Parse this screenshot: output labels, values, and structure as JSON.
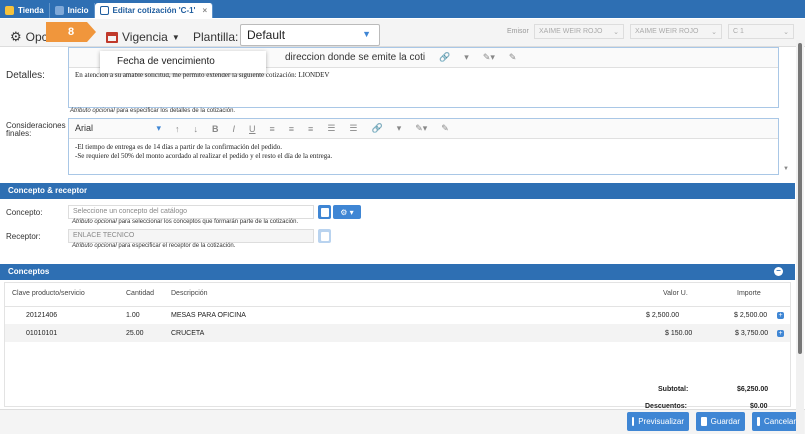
{
  "tabs": [
    {
      "label": "Tienda"
    },
    {
      "label": "Inicio"
    },
    {
      "label": "Editar cotización 'C-1'"
    }
  ],
  "toolbar": {
    "opciones": "Opc",
    "step_badge": "8",
    "vigencia": "Vigencia",
    "plantilla_label": "Plantilla:",
    "plantilla_value": "Default",
    "emisor_label": "Emisor",
    "emisor_value1": "XAIME WEIR ROJO",
    "emisor_value2": "XAIME WEIR ROJO",
    "serie": "C 1"
  },
  "dropdown": {
    "item": "Fecha de vencimiento"
  },
  "detalles": {
    "label": "Detalles:",
    "placeholder": "direccion donde se emite la coti",
    "text": "En atención a su amable solicitud, me permito extender la siguiente cotización: LIONDEV",
    "hint_em": "Atributo opcional",
    "hint_rest": " para especificar los detalles de la cotización."
  },
  "consideraciones": {
    "label1": "Consideraciones",
    "label2": "finales:",
    "font": "Arial",
    "line1": "-El tiempo de entrega es de 14 días a partir de la confirmación del pedido.",
    "line2": "-Se requiere del 50% del monto acordado al realizar el pedido y el resto el día de la entrega."
  },
  "concepto_receptor": {
    "title": "Concepto & receptor",
    "concepto_label": "Concepto:",
    "concepto_placeholder": "Seleccione un concepto del catálogo",
    "concepto_hint_em": "Atributo opcional",
    "concepto_hint": " para seleccionar los conceptos que formarán parte de la cotización.",
    "receptor_label": "Receptor:",
    "receptor_value": "ENLACE TECNICO",
    "receptor_hint_em": "Atributo opcional",
    "receptor_hint": " para especificar el receptor de la cotización."
  },
  "conceptos": {
    "title": "Conceptos",
    "headers": [
      "Clave producto/servicio",
      "Cantidad",
      "Descripción",
      "Valor U.",
      "Importe"
    ],
    "rows": [
      {
        "clave": "20121406",
        "cantidad": "1.00",
        "descripcion": "MESAS PARA OFICINA",
        "valor": "$ 2,500.00",
        "importe": "$ 2,500.00"
      },
      {
        "clave": "01010101",
        "cantidad": "25.00",
        "descripcion": "CRUCETA",
        "valor": "$ 150.00",
        "importe": "$ 3,750.00"
      }
    ],
    "subtotal_label": "Subtotal:",
    "subtotal": "$6,250.00",
    "descuentos_label": "Descuentos:",
    "descuentos": "$0.00"
  },
  "footer": {
    "previsualizar": "Previsualizar",
    "guardar": "Guardar",
    "cancelar": "Cancelar"
  },
  "colors": {
    "primary": "#2e6fb3",
    "accent": "#f0963c"
  }
}
